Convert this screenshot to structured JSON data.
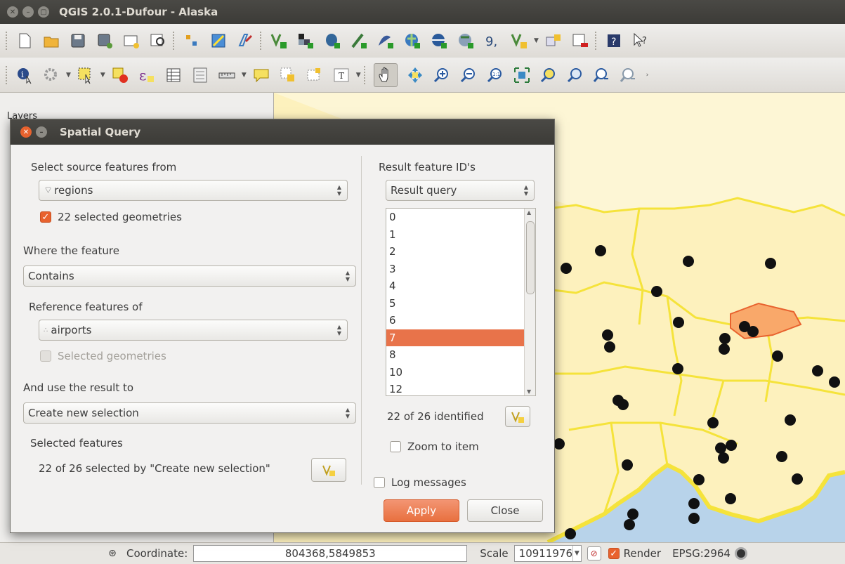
{
  "window": {
    "title": "QGIS 2.0.1-Dufour - Alaska"
  },
  "layers_panel": {
    "title": "Layers"
  },
  "dialog": {
    "title": "Spatial Query",
    "source_label": "Select source features from",
    "source_layer": "regions",
    "source_selected_label": "22 selected geometries",
    "where_label": "Where the feature",
    "predicate": "Contains",
    "reference_label": "Reference features of",
    "reference_layer": "airports",
    "reference_selected_label": "Selected geometries",
    "use_result_label": "And use the result to",
    "result_action": "Create new selection",
    "selected_features_label": "Selected features",
    "selected_summary": "22 of 26 selected by \"Create new selection\"",
    "result_ids_label": "Result feature ID's",
    "result_combo": "Result query",
    "result_ids": [
      "0",
      "1",
      "2",
      "3",
      "4",
      "5",
      "6",
      "7",
      "8",
      "10",
      "12"
    ],
    "selected_id": "7",
    "identified_summary": "22 of 26 identified",
    "zoom_label": "Zoom to item",
    "log_label": "Log messages",
    "apply_label": "Apply",
    "close_label": "Close"
  },
  "statusbar": {
    "coordinate_label": "Coordinate:",
    "coordinate_value": "804368,5849853",
    "scale_label": "Scale",
    "scale_value": "10911976",
    "render_label": "Render",
    "crs": "EPSG:2964"
  },
  "colors": {
    "accent": "#e8622e",
    "selection": "#e8734a",
    "map_land": "#fdf1bd",
    "map_water": "#b8d3ea",
    "boundary": "#f5e33b"
  }
}
